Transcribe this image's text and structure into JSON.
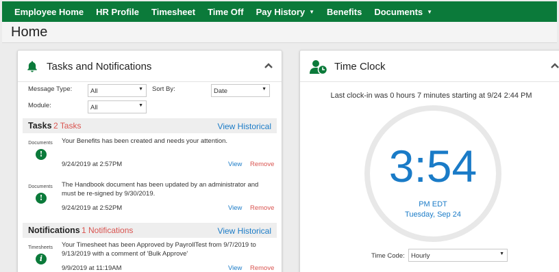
{
  "nav": {
    "items": [
      {
        "label": "Employee Home",
        "dropdown": false
      },
      {
        "label": "HR Profile",
        "dropdown": false
      },
      {
        "label": "Timesheet",
        "dropdown": false
      },
      {
        "label": "Time Off",
        "dropdown": false
      },
      {
        "label": "Pay History",
        "dropdown": true
      },
      {
        "label": "Benefits",
        "dropdown": false
      },
      {
        "label": "Documents",
        "dropdown": true
      }
    ]
  },
  "page": {
    "title": "Home"
  },
  "tasks_panel": {
    "title": "Tasks and Notifications",
    "filters": {
      "message_type_label": "Message Type:",
      "message_type_value": "All",
      "sort_by_label": "Sort By:",
      "sort_by_value": "Date",
      "module_label": "Module:",
      "module_value": "All"
    },
    "tasks": {
      "title": "Tasks",
      "count": "2 Tasks",
      "link": "View Historical",
      "items": [
        {
          "category": "Documents",
          "icon": "exclamation-icon",
          "message": "Your Benefits has been created and needs your attention.",
          "date": "9/24/2019 at 2:57PM",
          "view": "View",
          "remove": "Remove"
        },
        {
          "category": "Documents",
          "icon": "exclamation-icon",
          "message": "The Handbook document has been updated by an administrator and must be re-signed by 9/30/2019.",
          "date": "9/24/2019 at 2:52PM",
          "view": "View",
          "remove": "Remove"
        }
      ]
    },
    "notifications": {
      "title": "Notifications",
      "count": "1 Notifications",
      "link": "View Historical",
      "items": [
        {
          "category": "Timesheets",
          "icon": "info-icon",
          "message": "Your Timesheet has been Approved by PayrollTest from 9/7/2019 to 9/13/2019 with a comment of 'Bulk Approve'",
          "date": "9/9/2019 at 11:19AM",
          "view": "View",
          "remove": "Remove"
        }
      ]
    }
  },
  "time_clock": {
    "title": "Time Clock",
    "last_clock_in": "Last clock-in was 0 hours 7 minutes starting at 9/24 2:44 PM",
    "time": "3:54",
    "ampm_tz": "PM EDT",
    "date": "Tuesday, Sep 24",
    "time_code_label": "Time Code:",
    "time_code_value": "Hourly"
  },
  "colors": {
    "brand_green": "#0b7a3a",
    "link_blue": "#1a7bc7",
    "alert_red": "#d9534f"
  }
}
